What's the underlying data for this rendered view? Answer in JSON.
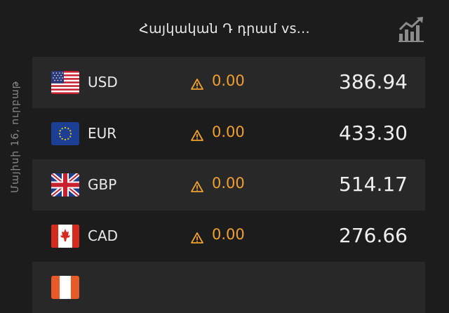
{
  "header": {
    "title": "Հայկական Դ դրամ vs..."
  },
  "sidebar": {
    "date": "Մայիսի 16, ուրբաթ"
  },
  "rates": [
    {
      "code": "USD",
      "change": "0.00",
      "value": "386.94",
      "flag": "us-flag-icon"
    },
    {
      "code": "EUR",
      "change": "0.00",
      "value": "433.30",
      "flag": "eu-flag-icon"
    },
    {
      "code": "GBP",
      "change": "0.00",
      "value": "514.17",
      "flag": "uk-flag-icon"
    },
    {
      "code": "CAD",
      "change": "0.00",
      "value": "276.66",
      "flag": "canada-flag-icon"
    }
  ],
  "colors": {
    "background": "#1c1c1c",
    "row_alt": "#282828",
    "change": "#f0a030",
    "muted": "#8a8a8a"
  }
}
